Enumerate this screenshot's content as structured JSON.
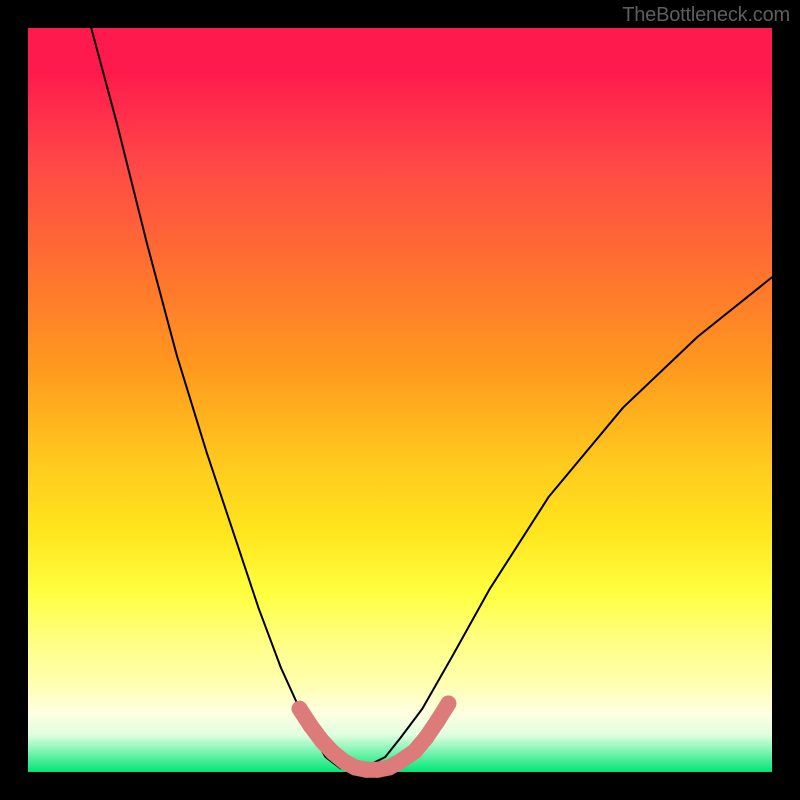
{
  "watermark": "TheBottleneck.com",
  "chart_data": {
    "type": "line",
    "title": "",
    "xlabel": "",
    "ylabel": "",
    "xlim": [
      0,
      1
    ],
    "ylim": [
      0,
      1
    ],
    "series": [
      {
        "name": "main-curve",
        "color": "#000000",
        "stroke": 2,
        "x": [
          0.085,
          0.12,
          0.16,
          0.2,
          0.24,
          0.28,
          0.31,
          0.34,
          0.365,
          0.385,
          0.4,
          0.42,
          0.45,
          0.48,
          0.5,
          0.53,
          0.57,
          0.62,
          0.7,
          0.8,
          0.9,
          1.0
        ],
        "y": [
          1.0,
          0.87,
          0.71,
          0.56,
          0.43,
          0.31,
          0.22,
          0.14,
          0.085,
          0.045,
          0.02,
          0.005,
          0.005,
          0.02,
          0.045,
          0.085,
          0.155,
          0.245,
          0.37,
          0.49,
          0.585,
          0.665
        ]
      },
      {
        "name": "marker-cluster",
        "color": "#dd7b7b",
        "stroke": 16,
        "x": [
          0.365,
          0.38,
          0.395,
          0.41,
          0.425,
          0.44,
          0.455,
          0.47,
          0.485,
          0.5,
          0.52,
          0.535,
          0.55,
          0.565
        ],
        "y": [
          0.085,
          0.062,
          0.042,
          0.026,
          0.014,
          0.006,
          0.003,
          0.003,
          0.006,
          0.014,
          0.028,
          0.046,
          0.068,
          0.092
        ]
      }
    ]
  }
}
